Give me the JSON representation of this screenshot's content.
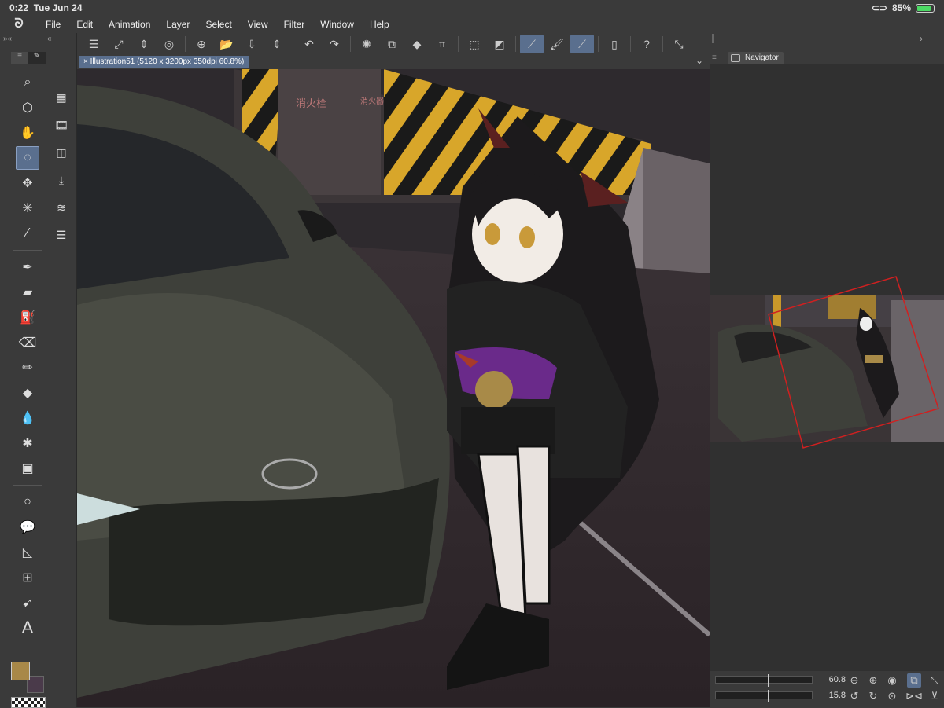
{
  "status": {
    "time": "0:22",
    "date": "Tue Jun 24",
    "battery_text": "85%",
    "battery_level": 0.85
  },
  "menu": {
    "items": [
      "File",
      "Edit",
      "Animation",
      "Layer",
      "Select",
      "View",
      "Filter",
      "Window",
      "Help"
    ]
  },
  "document": {
    "tab_label": "Illustration51 (5120 x 3200px 350dpi 60.8%)",
    "close": "×"
  },
  "navigator": {
    "panel_title": "Navigator",
    "zoom_value": "60.8",
    "rotation_value": "15.8",
    "zoom_level": 0.608
  },
  "canvas": {
    "sign_text": "消火栓",
    "sign_text_2": "消火器"
  },
  "colors": {
    "main": "#a88848",
    "sub": "#4a3a4a",
    "accent": "#5a6f8e"
  },
  "tools": [
    "zoom-icon",
    "object-icon",
    "hand-icon",
    "lasso-icon",
    "move-icon",
    "auto-select-icon",
    "eyedropper-icon",
    "pen-icon",
    "marker-icon",
    "airbrush-icon",
    "eraser-icon",
    "pencil-icon",
    "fill-icon",
    "blend-icon",
    "decoration-icon",
    "gradient-icon",
    "figure-icon",
    "balloon-icon",
    "ruler-icon",
    "frame-icon",
    "operation-icon",
    "text-icon"
  ]
}
